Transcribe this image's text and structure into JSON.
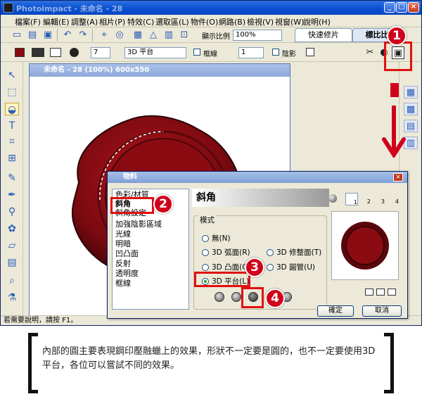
{
  "app": {
    "title": "Photoimpact - 未命名 - 28",
    "window_buttons": [
      "_",
      "□",
      "×"
    ]
  },
  "menu": [
    "檔案(F)",
    "編輯(E)",
    "調整(A)",
    "相片(P)",
    "特效(C)",
    "選取區(L)",
    "物件(O)",
    "網路(B)",
    "檢視(V)",
    "視窗(W)",
    "說明(H)"
  ],
  "toolbar1": {
    "zoom_label": "顯示比例",
    "zoom_value": "100%",
    "tabs": [
      "快速修片",
      "標比比"
    ]
  },
  "toolbar2": {
    "width_value": "7",
    "mode_value": "3D 平台",
    "frame_label": "框線",
    "frame_value": "1",
    "shadow_label": "陰影"
  },
  "canvas": {
    "title": "未命名 - 28 (100%) 600x550"
  },
  "status": "若需要說明，請按 F1。",
  "dialog": {
    "title": "物料",
    "categories": [
      "色彩/材質",
      "斜角",
      "斜角設定",
      "加強陰影區域",
      "光線",
      "明暗",
      "凹凸面",
      "反射",
      "透明度",
      "框線"
    ],
    "selected_category": "斜角",
    "header": "斜角",
    "group_label": "模式",
    "radios": [
      {
        "label": "無(N)",
        "on": false
      },
      {
        "label": "3D 弧面(R)",
        "on": false
      },
      {
        "label": "3D 修整面(T)",
        "on": false
      },
      {
        "label": "3D 凸面(C)",
        "on": false
      },
      {
        "label": "3D 圓管(U)",
        "on": false
      },
      {
        "label": "3D 平台(L)",
        "on": true
      }
    ],
    "light_numbers": [
      "1",
      "2",
      "3",
      "4"
    ],
    "ok_label": "確定",
    "cancel_label": "取消"
  },
  "annotations": {
    "badges": [
      "1",
      "2",
      "3",
      "4"
    ]
  },
  "caption": "內部的圓主要表現鋼印壓融蠟上的效果，形狀不一定要是圓的，也不一定要使用3D平台，各位可以嘗試不同的效果。",
  "colors": {
    "accent_red": "#d0021b",
    "wax_red": "#8a0c12",
    "title_blue": "#0a4fd0"
  }
}
